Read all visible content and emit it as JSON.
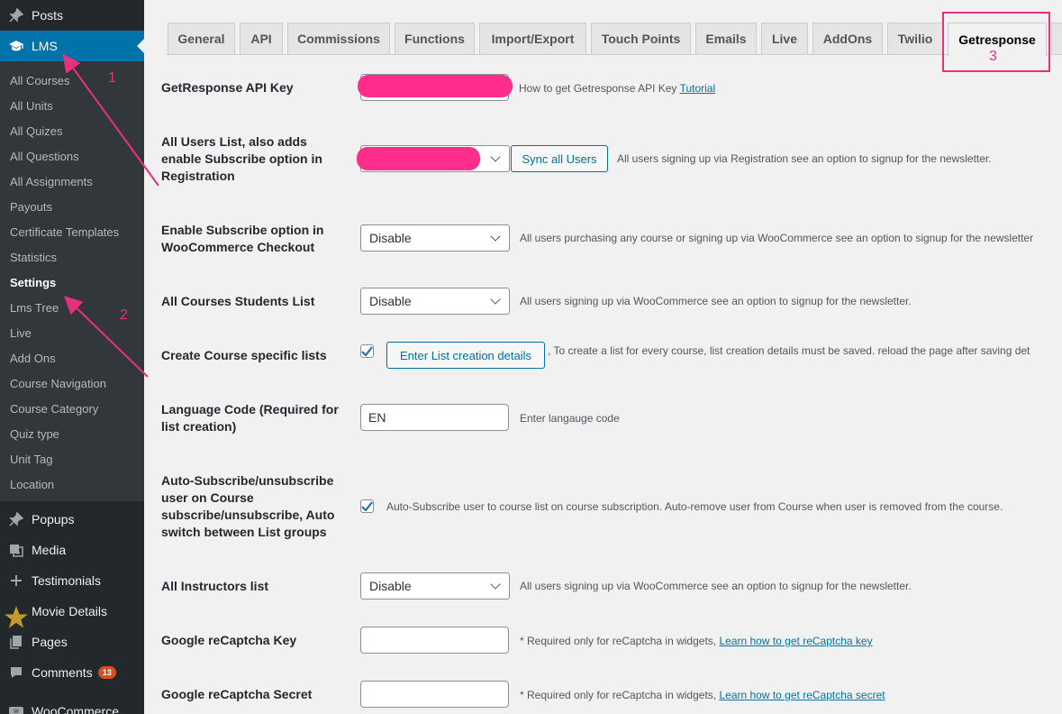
{
  "sidebar": {
    "posts": "Posts",
    "lms": "LMS",
    "lms_submenu": [
      "All Courses",
      "All Units",
      "All Quizes",
      "All Questions",
      "All Assignments",
      "Payouts",
      "Certificate Templates",
      "Statistics",
      "Settings",
      "Lms Tree",
      "Live",
      "Add Ons",
      "Course Navigation",
      "Course Category",
      "Quiz type",
      "Unit Tag",
      "Location"
    ],
    "popups": "Popups",
    "media": "Media",
    "testimonials": "Testimonials",
    "movie_details": "Movie Details",
    "pages": "Pages",
    "comments": "Comments",
    "comments_count": "13",
    "woocommerce": "WooCommerce"
  },
  "tabs": [
    "General",
    "API",
    "Commissions",
    "Functions",
    "Import/Export",
    "Touch Points",
    "Emails",
    "Live",
    "AddOns",
    "Twilio",
    "Getresponse"
  ],
  "active_tab": "Getresponse",
  "form": {
    "api_key": {
      "label": "GetResponse API Key",
      "desc": "How to get Getresponse API Key",
      "link": "Tutorial"
    },
    "all_users_list": {
      "label": "All Users List, also adds enable Subscribe option in Registration",
      "button": "Sync all Users",
      "desc": "All users signing up via Registration see an option to signup for the newsletter."
    },
    "woo_checkout": {
      "label": "Enable Subscribe option in WooCommerce Checkout",
      "value": "Disable",
      "desc": "All users purchasing any course or signing up via WooCommerce see an option to signup for the newsletter"
    },
    "courses_students": {
      "label": "All Courses Students List",
      "value": "Disable",
      "desc": "All users signing up via WooCommerce see an option to signup for the newsletter."
    },
    "course_lists": {
      "label": "Create Course specific lists",
      "checked": true,
      "button": "Enter List creation details",
      "desc": ", To create a list for every course, list creation details must be saved. reload the page after saving det"
    },
    "language_code": {
      "label": "Language Code (Required for list creation)",
      "value": "EN",
      "desc": "Enter langauge code"
    },
    "auto_subscribe": {
      "label": "Auto-Subscribe/unsubscribe user on Course subscribe/unsubscribe, Auto switch between List groups",
      "checked": true,
      "desc": "Auto-Subscribe user to course list on course subscription. Auto-remove user from Course when user is removed from the course."
    },
    "instructors_list": {
      "label": "All Instructors list",
      "value": "Disable",
      "desc": "All users signing up via WooCommerce see an option to signup for the newsletter."
    },
    "recaptcha_key": {
      "label": "Google reCaptcha Key",
      "desc": "* Required only for reCaptcha in widgets,",
      "link": "Learn how to get reCaptcha key"
    },
    "recaptcha_secret": {
      "label": "Google reCaptcha Secret",
      "desc": "* Required only for reCaptcha in widgets,",
      "link": "Learn how to get reCaptcha secret"
    }
  },
  "annotations": [
    "1",
    "2",
    "3"
  ],
  "colors": {
    "annotation": "#e8307e",
    "redaction": "#ff2e8c",
    "menu_active": "#0073aa"
  }
}
